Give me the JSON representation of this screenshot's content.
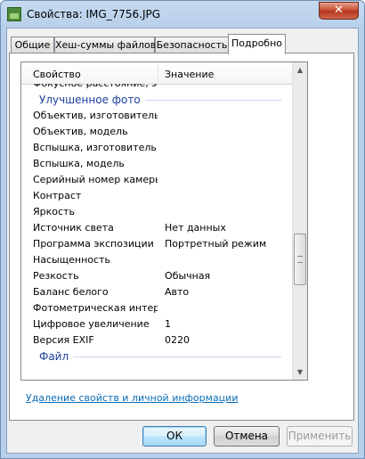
{
  "window": {
    "title": "Свойства: IMG_7756.JPG",
    "close_glyph": "✕"
  },
  "tabs": [
    {
      "label": "Общие"
    },
    {
      "label": "Хеш-суммы файлов"
    },
    {
      "label": "Безопасность"
    },
    {
      "label": "Подробно",
      "active": true
    }
  ],
  "list": {
    "headers": {
      "property": "Свойство",
      "value": "Значение"
    },
    "rows": [
      {
        "property": "Фокусное расстояние, э...",
        "value": ""
      },
      {
        "property": "Улучшенное фото",
        "value": "",
        "group": true
      },
      {
        "property": "Объектив, изготовитель",
        "value": ""
      },
      {
        "property": "Объектив, модель",
        "value": ""
      },
      {
        "property": "Вспышка, изготовитель",
        "value": ""
      },
      {
        "property": "Вспышка, модель",
        "value": ""
      },
      {
        "property": "Серийный номер камеры",
        "value": ""
      },
      {
        "property": "Контраст",
        "value": ""
      },
      {
        "property": "Яркость",
        "value": ""
      },
      {
        "property": "Источник света",
        "value": "Нет данных"
      },
      {
        "property": "Программа экспозиции",
        "value": "Портретный режим"
      },
      {
        "property": "Насыщенность",
        "value": ""
      },
      {
        "property": "Резкость",
        "value": "Обычная"
      },
      {
        "property": "Баланс белого",
        "value": "Авто"
      },
      {
        "property": "Фотометрическая интер...",
        "value": ""
      },
      {
        "property": "Цифровое увеличение",
        "value": "1"
      },
      {
        "property": "Версия EXIF",
        "value": "0220"
      },
      {
        "property": "Файл",
        "value": "",
        "group": true
      }
    ]
  },
  "link": {
    "text": "Удаление свойств и личной информации"
  },
  "buttons": {
    "ok": "ОК",
    "cancel": "Отмена",
    "apply": "Применить"
  },
  "colors": {
    "group_text": "#1e3f9c",
    "link": "#0b6db7"
  }
}
